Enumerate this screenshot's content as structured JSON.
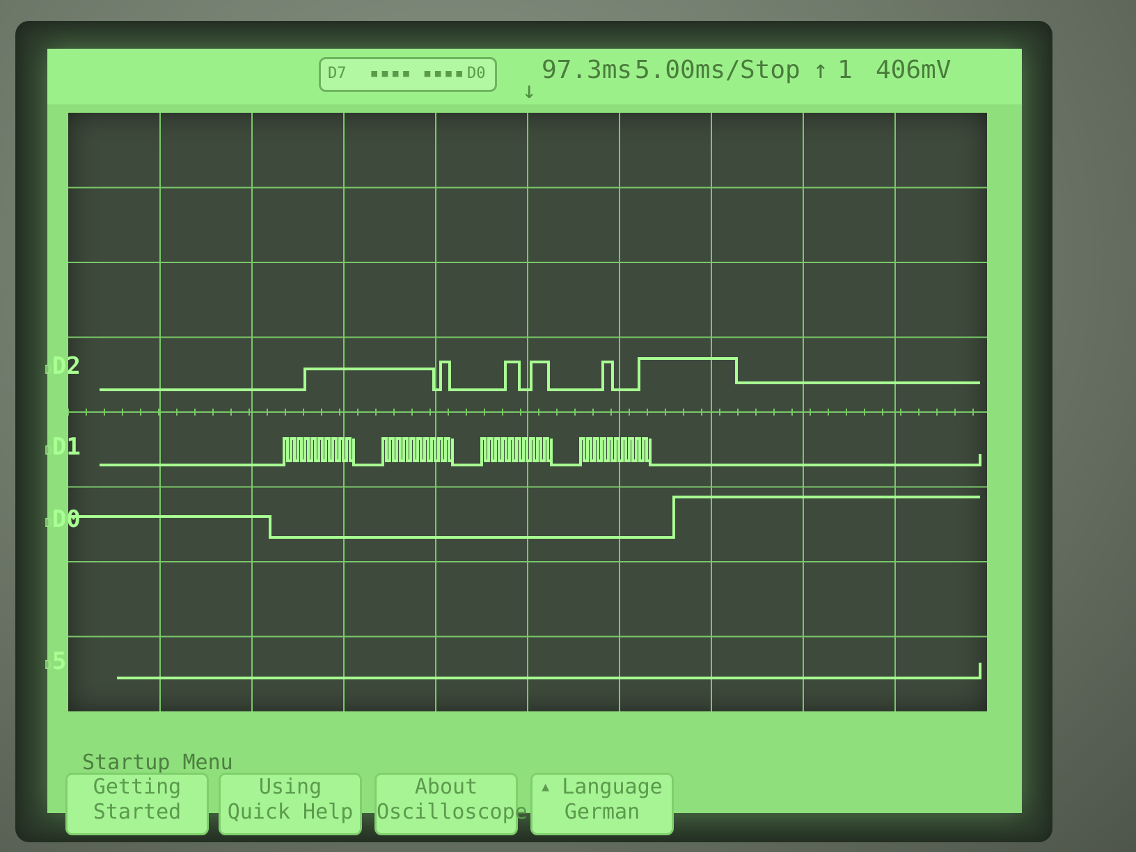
{
  "status": {
    "channel_badge": {
      "left": "D7",
      "dots": "▪▪▪▪ ▪▪▪▪",
      "right": "D0"
    },
    "trigger_marker": "↓",
    "time_offset": "97.3ms",
    "time_per_div": "5.00ms/",
    "run_state": "Stop",
    "trigger_icon": "↑",
    "trigger_source": "1",
    "trigger_level": "406mV"
  },
  "channels": [
    {
      "name": "D2",
      "tag": "D2"
    },
    {
      "name": "D1",
      "tag": "D1"
    },
    {
      "name": "D0",
      "tag": "D0"
    },
    {
      "name": "5",
      "tag": "D→"
    }
  ],
  "menu": {
    "title": "Startup Menu",
    "softkeys": [
      {
        "line1": "Getting",
        "line2": "Started"
      },
      {
        "line1": "Using",
        "line2": "Quick Help"
      },
      {
        "line1": "About",
        "line2": "Oscilloscope"
      },
      {
        "line1": "Language",
        "line2": "German",
        "indicator": "▲"
      }
    ]
  },
  "colors": {
    "trace": "#a8ff92",
    "screen": "#8fe07d",
    "grid": "#79c868"
  }
}
